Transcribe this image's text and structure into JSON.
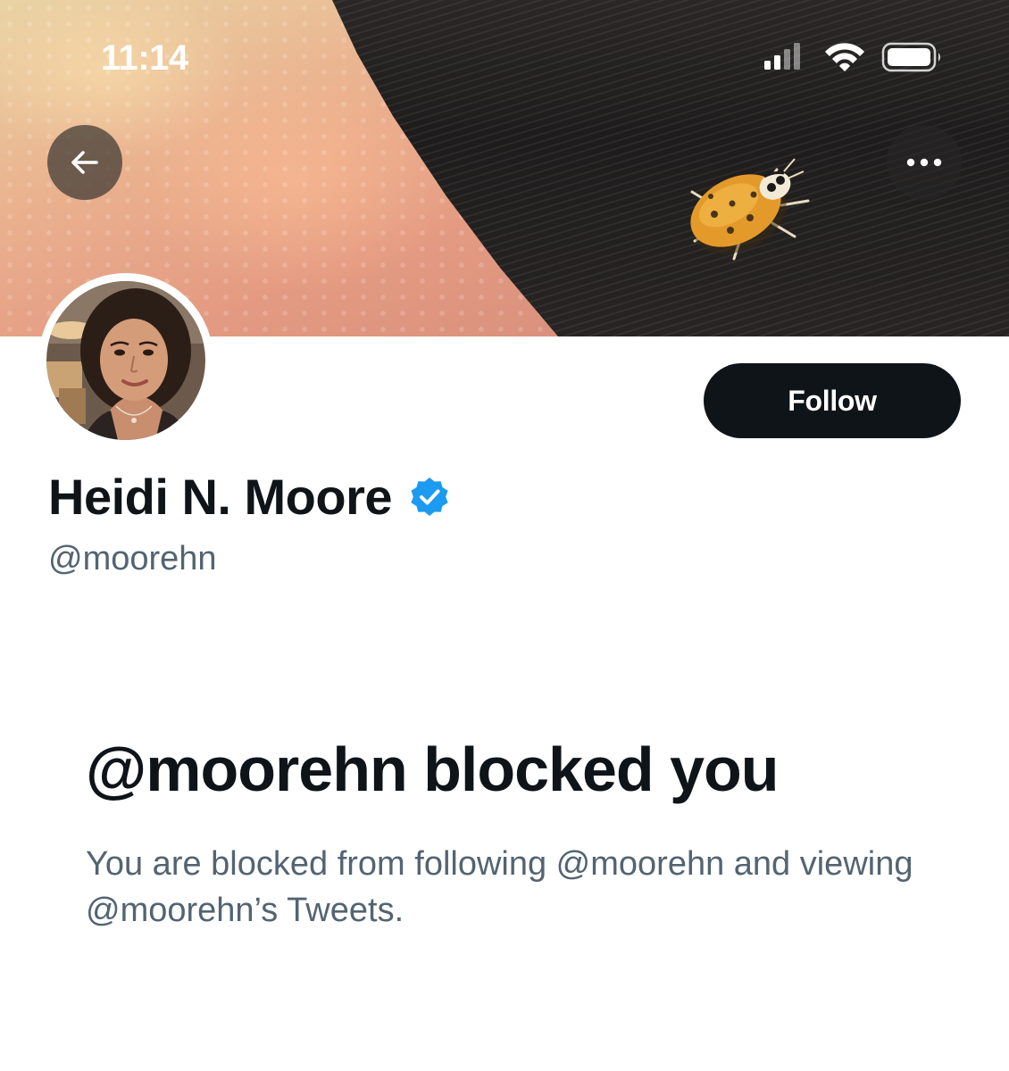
{
  "status_bar": {
    "time": "11:14",
    "icons": [
      "cellular-signal-icon",
      "wifi-icon",
      "battery-icon"
    ]
  },
  "header": {
    "back_icon": "arrow-left-icon",
    "more_icon": "more-horizontal-icon"
  },
  "profile": {
    "name": "Heidi N. Moore",
    "handle": "@moorehn",
    "verified": true,
    "verified_icon": "verified-badge-icon",
    "follow_label": "Follow"
  },
  "blocked_notice": {
    "title": "@moorehn blocked you",
    "message": "You are blocked from following @moorehn and viewing @moorehn’s Tweets."
  },
  "colors": {
    "text_primary": "#0f1419",
    "text_secondary": "#536471",
    "follow_button_bg": "#0f1419",
    "verified_blue": "#1d9bf0"
  }
}
